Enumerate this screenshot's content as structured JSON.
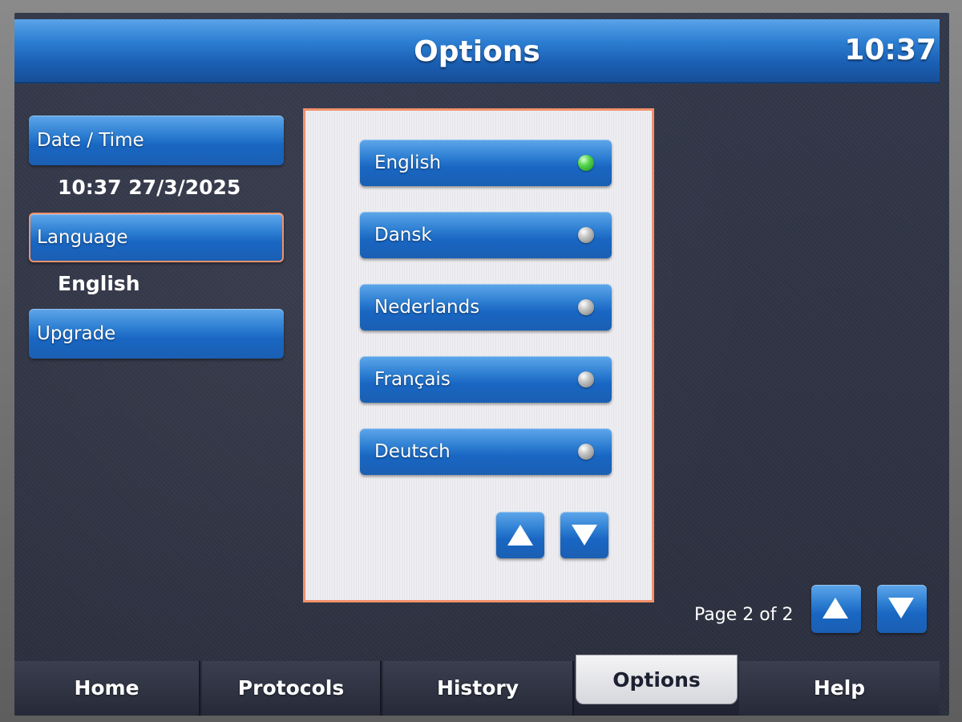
{
  "header": {
    "title": "Options",
    "clock": "10:37"
  },
  "settings": {
    "date_time": {
      "label": "Date / Time",
      "value": "10:37  27/3/2025"
    },
    "language": {
      "label": "Language",
      "value": "English"
    },
    "upgrade": {
      "label": "Upgrade"
    }
  },
  "languages": [
    {
      "label": "English",
      "selected": true
    },
    {
      "label": "Dansk",
      "selected": false
    },
    {
      "label": "Nederlands",
      "selected": false
    },
    {
      "label": "Français",
      "selected": false
    },
    {
      "label": "Deutsch",
      "selected": false
    }
  ],
  "pager": {
    "label": "Page 2 of 2"
  },
  "tabs": [
    {
      "label": "Home",
      "active": false
    },
    {
      "label": "Protocols",
      "active": false
    },
    {
      "label": "History",
      "active": false
    },
    {
      "label": "Options",
      "active": true
    },
    {
      "label": "Help",
      "active": false
    }
  ],
  "colors": {
    "accent_blue": "#2b7dd1",
    "selection_outline": "#f2916b",
    "indicator_on": "#52d44c",
    "indicator_off": "#c8c8c8"
  },
  "icons": {
    "scroll_up": "triangle-up-icon",
    "scroll_down": "triangle-down-icon",
    "indicator": "radio-dot-icon"
  }
}
